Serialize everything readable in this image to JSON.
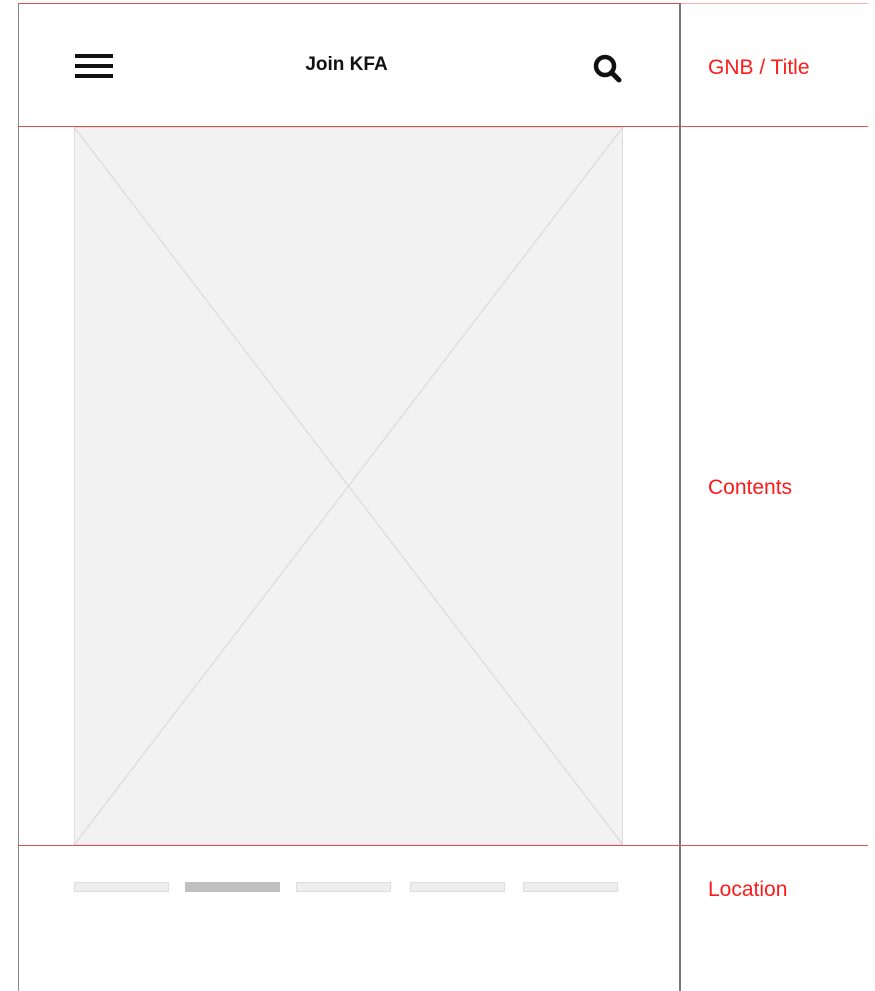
{
  "header": {
    "title": "Join KFA",
    "menu_icon": "hamburger-menu-icon",
    "search_icon": "search-icon"
  },
  "contents": {
    "placeholder": "image-placeholder"
  },
  "location": {
    "total": 5,
    "active_index": 1
  },
  "annotations": {
    "gnb": "GNB / Title",
    "contents": "Contents",
    "location": "Location"
  },
  "colors": {
    "annotation": "#ff1a1a",
    "guide_line": "#e05050",
    "placeholder_fill": "#f2f2f2",
    "indicator_active": "#c0c0c0",
    "indicator_inactive": "#eeeeee"
  }
}
